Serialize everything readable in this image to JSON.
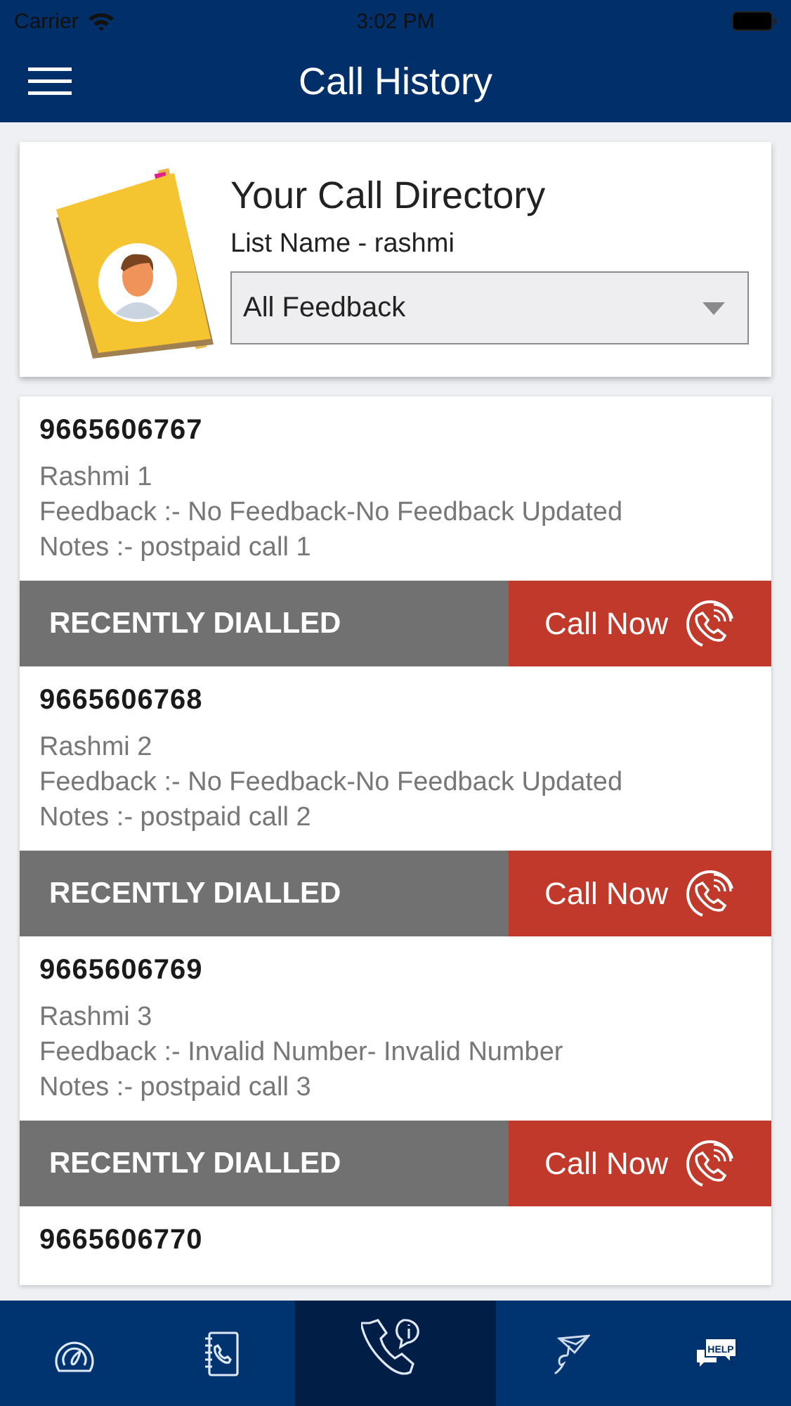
{
  "status_bar": {
    "carrier": "Carrier",
    "time": "3:02 PM"
  },
  "nav": {
    "title": "Call History"
  },
  "directory": {
    "title": "Your Call Directory",
    "list_name": "List Name - rashmi",
    "filter": {
      "value": "All Feedback"
    }
  },
  "calls": [
    {
      "number": "9665606767",
      "name": "Rashmi 1",
      "feedback": "Feedback :- No Feedback-No Feedback Updated",
      "notes": "Notes :- postpaid call 1",
      "status": "RECENTLY DIALLED",
      "action": "Call Now"
    },
    {
      "number": "9665606768",
      "name": "Rashmi 2",
      "feedback": "Feedback :- No Feedback-No Feedback Updated",
      "notes": "Notes :- postpaid call 2",
      "status": "RECENTLY DIALLED",
      "action": "Call Now"
    },
    {
      "number": "9665606769",
      "name": "Rashmi 3",
      "feedback": "Feedback :- Invalid Number- Invalid Number",
      "notes": "Notes :- postpaid call 3",
      "status": "RECENTLY DIALLED",
      "action": "Call Now"
    },
    {
      "number": "9665606770"
    }
  ],
  "tabs": [
    {
      "kind": "dashboard",
      "selected": false
    },
    {
      "kind": "contacts",
      "selected": false
    },
    {
      "kind": "history",
      "selected": true
    },
    {
      "kind": "send",
      "selected": false
    },
    {
      "kind": "help",
      "selected": false,
      "label": "HELP"
    }
  ]
}
